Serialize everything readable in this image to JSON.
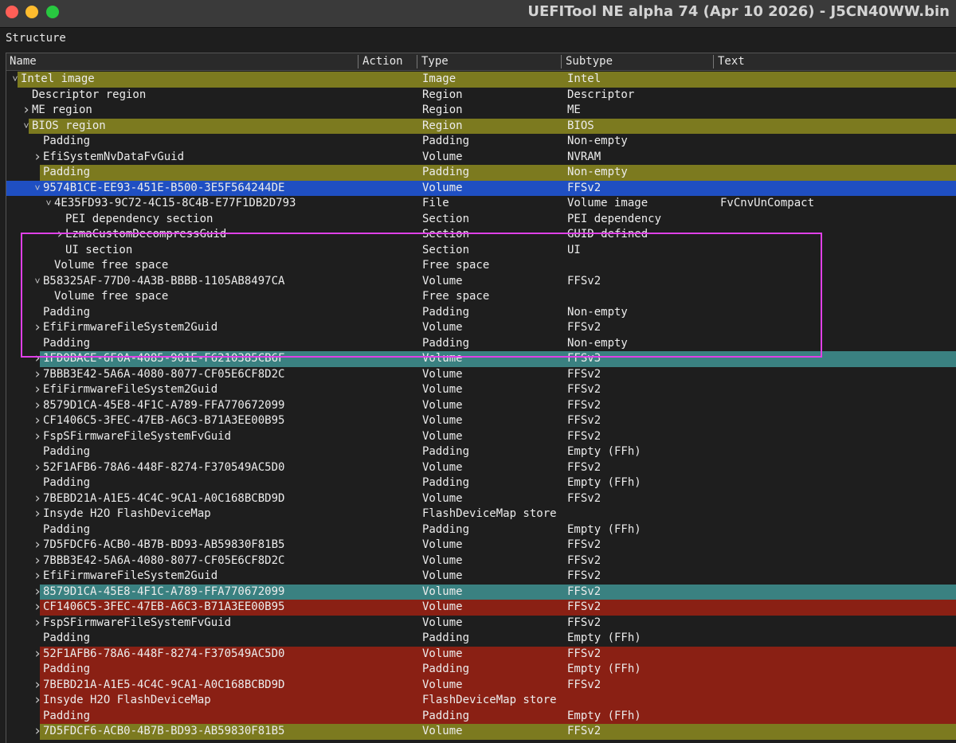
{
  "window": {
    "title": "UEFITool NE alpha 74 (Apr 10 2026) - J5CN40WW.bin"
  },
  "panel": {
    "label": "Structure"
  },
  "columns": [
    {
      "label": "Name"
    },
    {
      "label": "Action"
    },
    {
      "label": "Type"
    },
    {
      "label": "Subtype"
    },
    {
      "label": "Text"
    }
  ],
  "colors": {
    "olive": "#7c7a1f",
    "selected": "#1f4fc2",
    "teal": "#3a8181",
    "red": "#8a2014"
  },
  "rows": [
    {
      "name": "Intel image",
      "type": "Image",
      "subtype": "Intel",
      "text": "",
      "depth": 0,
      "arrow": "chevron-down-icon",
      "color": "olive"
    },
    {
      "name": "Descriptor region",
      "type": "Region",
      "subtype": "Descriptor",
      "text": "",
      "depth": 1,
      "arrow": "",
      "color": ""
    },
    {
      "name": "ME region",
      "type": "Region",
      "subtype": "ME",
      "text": "",
      "depth": 1,
      "arrow": "chevron-right-icon",
      "color": ""
    },
    {
      "name": "BIOS region",
      "type": "Region",
      "subtype": "BIOS",
      "text": "",
      "depth": 1,
      "arrow": "chevron-down-icon",
      "color": "olive"
    },
    {
      "name": "Padding",
      "type": "Padding",
      "subtype": "Non-empty",
      "text": "",
      "depth": 2,
      "arrow": "",
      "color": ""
    },
    {
      "name": "EfiSystemNvDataFvGuid",
      "type": "Volume",
      "subtype": "NVRAM",
      "text": "",
      "depth": 2,
      "arrow": "chevron-right-icon",
      "color": ""
    },
    {
      "name": "Padding",
      "type": "Padding",
      "subtype": "Non-empty",
      "text": "",
      "depth": 2,
      "arrow": "",
      "color": "olive"
    },
    {
      "name": "9574B1CE-EE93-451E-B500-3E5F564244DE",
      "type": "Volume",
      "subtype": "FFSv2",
      "text": "",
      "depth": 2,
      "arrow": "chevron-down-icon",
      "color": "selected"
    },
    {
      "name": "4E35FD93-9C72-4C15-8C4B-E77F1DB2D793",
      "type": "File",
      "subtype": "Volume image",
      "text": "FvCnvUnCompact",
      "depth": 3,
      "arrow": "chevron-down-icon",
      "color": ""
    },
    {
      "name": "PEI dependency section",
      "type": "Section",
      "subtype": "PEI dependency",
      "text": "",
      "depth": 4,
      "arrow": "",
      "color": ""
    },
    {
      "name": "LzmaCustomDecompressGuid",
      "type": "Section",
      "subtype": "GUID defined",
      "text": "",
      "depth": 4,
      "arrow": "chevron-right-icon",
      "color": ""
    },
    {
      "name": "UI section",
      "type": "Section",
      "subtype": "UI",
      "text": "",
      "depth": 4,
      "arrow": "",
      "color": ""
    },
    {
      "name": "Volume free space",
      "type": "Free space",
      "subtype": "",
      "text": "",
      "depth": 3,
      "arrow": "",
      "color": ""
    },
    {
      "name": "B58325AF-77D0-4A3B-BBBB-1105AB8497CA",
      "type": "Volume",
      "subtype": "FFSv2",
      "text": "",
      "depth": 2,
      "arrow": "chevron-down-icon",
      "color": ""
    },
    {
      "name": "Volume free space",
      "type": "Free space",
      "subtype": "",
      "text": "",
      "depth": 3,
      "arrow": "",
      "color": ""
    },
    {
      "name": "Padding",
      "type": "Padding",
      "subtype": "Non-empty",
      "text": "",
      "depth": 2,
      "arrow": "",
      "color": ""
    },
    {
      "name": "EfiFirmwareFileSystem2Guid",
      "type": "Volume",
      "subtype": "FFSv2",
      "text": "",
      "depth": 2,
      "arrow": "chevron-right-icon",
      "color": ""
    },
    {
      "name": "Padding",
      "type": "Padding",
      "subtype": "Non-empty",
      "text": "",
      "depth": 2,
      "arrow": "",
      "color": ""
    },
    {
      "name": "1FD0BACE-6F0A-4085-901E-F6210385CB6F",
      "type": "Volume",
      "subtype": "FFSv3",
      "text": "",
      "depth": 2,
      "arrow": "chevron-right-icon",
      "color": "teal"
    },
    {
      "name": "7BBB3E42-5A6A-4080-8077-CF05E6CF8D2C",
      "type": "Volume",
      "subtype": "FFSv2",
      "text": "",
      "depth": 2,
      "arrow": "chevron-right-icon",
      "color": ""
    },
    {
      "name": "EfiFirmwareFileSystem2Guid",
      "type": "Volume",
      "subtype": "FFSv2",
      "text": "",
      "depth": 2,
      "arrow": "chevron-right-icon",
      "color": ""
    },
    {
      "name": "8579D1CA-45E8-4F1C-A789-FFA770672099",
      "type": "Volume",
      "subtype": "FFSv2",
      "text": "",
      "depth": 2,
      "arrow": "chevron-right-icon",
      "color": ""
    },
    {
      "name": "CF1406C5-3FEC-47EB-A6C3-B71A3EE00B95",
      "type": "Volume",
      "subtype": "FFSv2",
      "text": "",
      "depth": 2,
      "arrow": "chevron-right-icon",
      "color": ""
    },
    {
      "name": "FspSFirmwareFileSystemFvGuid",
      "type": "Volume",
      "subtype": "FFSv2",
      "text": "",
      "depth": 2,
      "arrow": "chevron-right-icon",
      "color": ""
    },
    {
      "name": "Padding",
      "type": "Padding",
      "subtype": "Empty (FFh)",
      "text": "",
      "depth": 2,
      "arrow": "",
      "color": ""
    },
    {
      "name": "52F1AFB6-78A6-448F-8274-F370549AC5D0",
      "type": "Volume",
      "subtype": "FFSv2",
      "text": "",
      "depth": 2,
      "arrow": "chevron-right-icon",
      "color": ""
    },
    {
      "name": "Padding",
      "type": "Padding",
      "subtype": "Empty (FFh)",
      "text": "",
      "depth": 2,
      "arrow": "",
      "color": ""
    },
    {
      "name": "7BEBD21A-A1E5-4C4C-9CA1-A0C168BCBD9D",
      "type": "Volume",
      "subtype": "FFSv2",
      "text": "",
      "depth": 2,
      "arrow": "chevron-right-icon",
      "color": ""
    },
    {
      "name": "Insyde H2O FlashDeviceMap",
      "type": "FlashDeviceMap store",
      "subtype": "",
      "text": "",
      "depth": 2,
      "arrow": "chevron-right-icon",
      "color": ""
    },
    {
      "name": "Padding",
      "type": "Padding",
      "subtype": "Empty (FFh)",
      "text": "",
      "depth": 2,
      "arrow": "",
      "color": ""
    },
    {
      "name": "7D5FDCF6-ACB0-4B7B-BD93-AB59830F81B5",
      "type": "Volume",
      "subtype": "FFSv2",
      "text": "",
      "depth": 2,
      "arrow": "chevron-right-icon",
      "color": ""
    },
    {
      "name": "7BBB3E42-5A6A-4080-8077-CF05E6CF8D2C",
      "type": "Volume",
      "subtype": "FFSv2",
      "text": "",
      "depth": 2,
      "arrow": "chevron-right-icon",
      "color": ""
    },
    {
      "name": "EfiFirmwareFileSystem2Guid",
      "type": "Volume",
      "subtype": "FFSv2",
      "text": "",
      "depth": 2,
      "arrow": "chevron-right-icon",
      "color": ""
    },
    {
      "name": "8579D1CA-45E8-4F1C-A789-FFA770672099",
      "type": "Volume",
      "subtype": "FFSv2",
      "text": "",
      "depth": 2,
      "arrow": "chevron-right-icon",
      "color": "teal"
    },
    {
      "name": "CF1406C5-3FEC-47EB-A6C3-B71A3EE00B95",
      "type": "Volume",
      "subtype": "FFSv2",
      "text": "",
      "depth": 2,
      "arrow": "chevron-right-icon",
      "color": "red"
    },
    {
      "name": "FspSFirmwareFileSystemFvGuid",
      "type": "Volume",
      "subtype": "FFSv2",
      "text": "",
      "depth": 2,
      "arrow": "chevron-right-icon",
      "color": ""
    },
    {
      "name": "Padding",
      "type": "Padding",
      "subtype": "Empty (FFh)",
      "text": "",
      "depth": 2,
      "arrow": "",
      "color": ""
    },
    {
      "name": "52F1AFB6-78A6-448F-8274-F370549AC5D0",
      "type": "Volume",
      "subtype": "FFSv2",
      "text": "",
      "depth": 2,
      "arrow": "chevron-right-icon",
      "color": "red"
    },
    {
      "name": "Padding",
      "type": "Padding",
      "subtype": "Empty (FFh)",
      "text": "",
      "depth": 2,
      "arrow": "",
      "color": "red"
    },
    {
      "name": "7BEBD21A-A1E5-4C4C-9CA1-A0C168BCBD9D",
      "type": "Volume",
      "subtype": "FFSv2",
      "text": "",
      "depth": 2,
      "arrow": "chevron-right-icon",
      "color": "red"
    },
    {
      "name": "Insyde H2O FlashDeviceMap",
      "type": "FlashDeviceMap store",
      "subtype": "",
      "text": "",
      "depth": 2,
      "arrow": "chevron-right-icon",
      "color": "red"
    },
    {
      "name": "Padding",
      "type": "Padding",
      "subtype": "Empty (FFh)",
      "text": "",
      "depth": 2,
      "arrow": "",
      "color": "red"
    },
    {
      "name": "7D5FDCF6-ACB0-4B7B-BD93-AB59830F81B5",
      "type": "Volume",
      "subtype": "FFSv2",
      "text": "",
      "depth": 2,
      "arrow": "chevron-right-icon",
      "color": "olive"
    }
  ]
}
